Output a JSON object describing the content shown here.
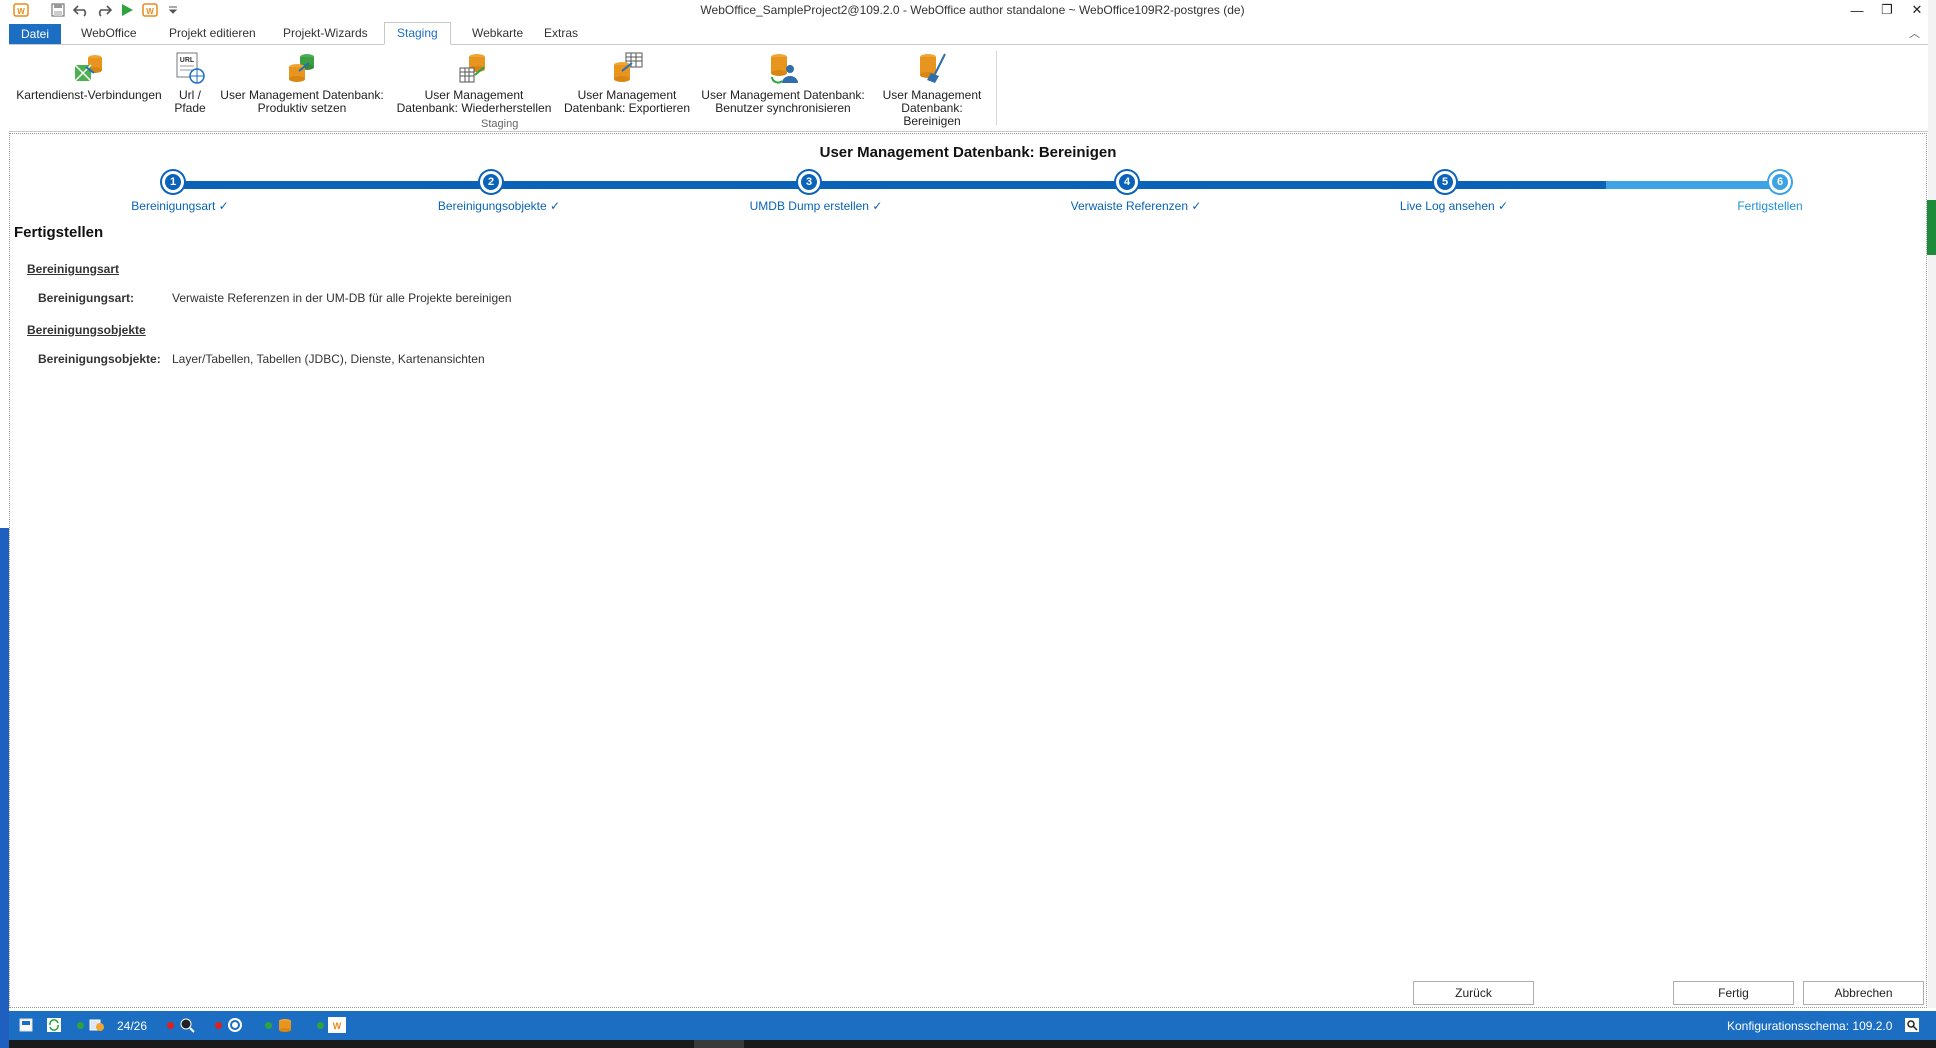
{
  "window": {
    "title": "WebOffice_SampleProject2@109.2.0 - WebOffice author standalone ~ WebOffice109R2-postgres (de)",
    "controls": {
      "minimize": "—",
      "restore": "❐",
      "close": "✕"
    }
  },
  "ribbon": {
    "tabs": [
      {
        "label": "Datei"
      },
      {
        "label": "WebOffice"
      },
      {
        "label": "Projekt editieren"
      },
      {
        "label": "Projekt-Wizards"
      },
      {
        "label": "Staging"
      },
      {
        "label": "Webkarte"
      },
      {
        "label": "Extras"
      }
    ],
    "active_tab": "Staging",
    "buttons": [
      {
        "line1": "Kartendienst-Verbindungen",
        "line2": ""
      },
      {
        "line1": "Url /",
        "line2": "Pfade"
      },
      {
        "line1": "User Management Datenbank:",
        "line2": "Produktiv setzen"
      },
      {
        "line1": "User Management",
        "line2": "Datenbank: Wiederherstellen"
      },
      {
        "line1": "User Management",
        "line2": "Datenbank: Exportieren"
      },
      {
        "line1": "User Management Datenbank:",
        "line2": "Benutzer synchronisieren"
      },
      {
        "line1": "User Management",
        "line2": "Datenbank: Bereinigen"
      }
    ],
    "group_label": "Staging"
  },
  "wizard": {
    "title": "User Management Datenbank: Bereinigen",
    "steps": [
      {
        "number": "1",
        "label": "Bereinigungsart ✓"
      },
      {
        "number": "2",
        "label": "Bereinigungsobjekte ✓"
      },
      {
        "number": "3",
        "label": "UMDB Dump erstellen ✓"
      },
      {
        "number": "4",
        "label": "Verwaiste Referenzen ✓"
      },
      {
        "number": "5",
        "label": "Live Log ansehen ✓"
      },
      {
        "number": "6",
        "label": "Fertigstellen"
      }
    ],
    "current_step": 6,
    "section_title": "Fertigstellen",
    "summary": [
      {
        "heading": "Bereinigungsart",
        "key": "Bereinigungsart:",
        "value": "Verwaiste Referenzen in der UM-DB für alle Projekte bereinigen"
      },
      {
        "heading": "Bereinigungsobjekte",
        "key": "Bereinigungsobjekte:",
        "value": "Layer/Tabellen, Tabellen (JDBC), Dienste, Kartenansichten"
      }
    ],
    "buttons": {
      "back": "Zurück",
      "finish": "Fertig",
      "cancel": "Abbrechen"
    }
  },
  "statusbar": {
    "counter": "24/26",
    "schema": "Konfigurationsschema: 109.2.0"
  },
  "colors": {
    "accent": "#1b6ec2",
    "step_done": "#0a63b8",
    "step_current": "#3ea3e4"
  }
}
